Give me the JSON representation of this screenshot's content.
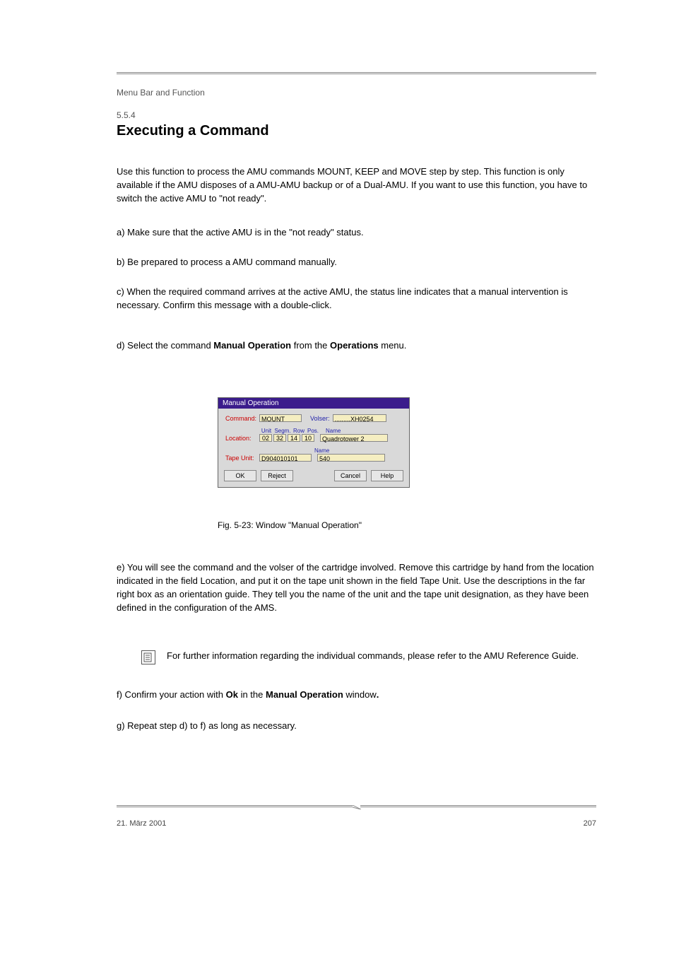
{
  "header_left": "Menu Bar and Function",
  "section_label": "5.5.4",
  "section_title": "Executing a Command",
  "para1": "Use this function to process the AMU commands MOUNT, KEEP and MOVE step by step. This function is only available if the AMU disposes of a AMU-AMU backup or of a Dual-AMU. If you want to use this function, you have to switch the active AMU to \"not ready\".",
  "para2": "a) Make sure that the active AMU is in the \"not ready\" status.",
  "para3": "b) Be prepared to process a AMU command manually.",
  "para4": "c) When the required command arrives at the active AMU, the status line indicates that a manual intervention is necessary. Confirm this message with a double-click.",
  "para5_pre": "d) Select the command ",
  "para5_b1": "Manual Operation",
  "para5_mid": " from the ",
  "para5_b2": "Operations",
  "para5_post": " menu.",
  "fig_caption": "Fig. 5-23: Window \"Manual Operation\"",
  "para6": "e) You will see the command and the volser of the cartridge involved. Remove this cartridge by hand from the location indicated in the field Location, and put it on the tape unit shown in the field Tape Unit. Use the descriptions in the far right box as an orientation guide. They tell you the name of the unit and the tape unit designation, as they have been defined in the configuration of the AMS.",
  "ref_text": "For further information regarding the individual commands, please refer to the AMU Reference Guide.",
  "para7_pre": "f) Confirm your action with ",
  "para7_b1": "Ok",
  "para7_mid": " in the ",
  "para7_b2": "Manual Operation ",
  "para7_post1": "window",
  "para7_post2": ".",
  "para8": "g) Repeat step d) to f) as long as necessary.",
  "footer_left": "21. März 2001",
  "footer_right": "207",
  "dialog": {
    "title": "Manual Operation",
    "command_label": "Command:",
    "command_value": "MOUNT",
    "volser_label": "Volser:",
    "volser_value": ".........XH0254",
    "loc_label": "Location:",
    "headers": {
      "unit": "Unit",
      "segm": "Segm.",
      "row": "Row",
      "pos": "Pos."
    },
    "loc": {
      "unit": "02",
      "segm": "32",
      "row": "14",
      "pos": "10"
    },
    "name_label": "Name",
    "loc_name": "Quadrotower 2",
    "tape_label": "Tape Unit:",
    "tape_value": "D904010101",
    "tape_name": "540",
    "buttons": {
      "ok": "OK",
      "reject": "Reject",
      "cancel": "Cancel",
      "help": "Help"
    }
  }
}
